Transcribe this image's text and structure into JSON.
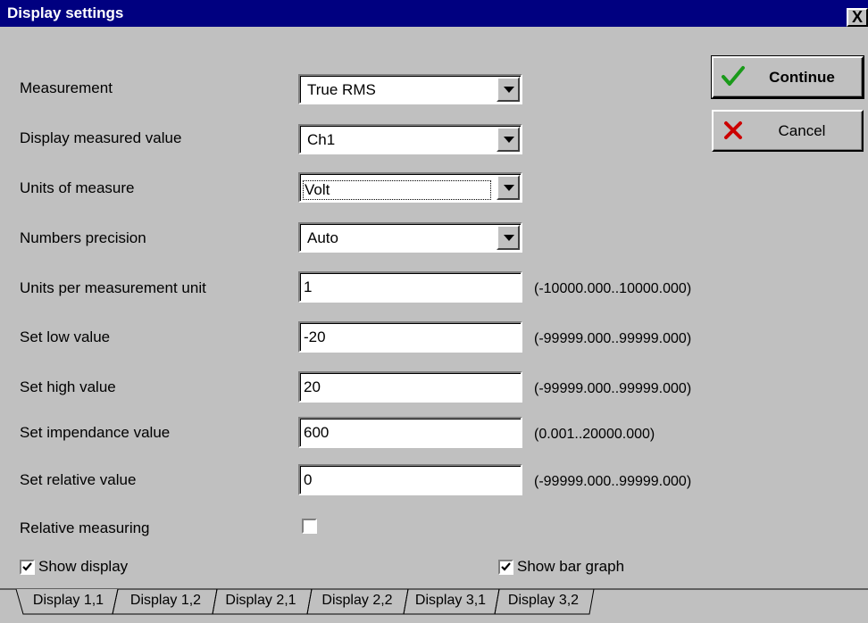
{
  "window": {
    "title": "Display settings",
    "close_label": "X"
  },
  "fields": {
    "measurement": {
      "label": "Measurement",
      "value": "True RMS"
    },
    "display_measured_value": {
      "label": "Display measured value",
      "value": "Ch1"
    },
    "units_of_measure": {
      "label": "Units of measure",
      "value": "Volt"
    },
    "numbers_precision": {
      "label": "Numbers precision",
      "value": "Auto"
    },
    "units_per_measurement_unit": {
      "label": "Units per measurement unit",
      "value": "1",
      "range": "(-10000.000..10000.000)"
    },
    "set_low_value": {
      "label": "Set low value",
      "value": "-20",
      "range": "(-99999.000..99999.000)"
    },
    "set_high_value": {
      "label": "Set high value",
      "value": "20",
      "range": "(-99999.000..99999.000)"
    },
    "set_impendance_value": {
      "label": "Set impendance value",
      "value": "600",
      "range": "(0.001..20000.000)"
    },
    "set_relative_value": {
      "label": "Set relative value",
      "value": "0",
      "range": "(-99999.000..99999.000)"
    }
  },
  "checkboxes": {
    "relative_measuring": {
      "label": "Relative measuring",
      "checked": false
    },
    "show_display": {
      "label": "Show display",
      "checked": true
    },
    "show_bar_graph": {
      "label": "Show bar graph",
      "checked": true
    }
  },
  "buttons": {
    "continue_label": "Continue",
    "cancel_label": "Cancel"
  },
  "tabs": [
    {
      "label": "Display 1,1",
      "active": true
    },
    {
      "label": "Display 1,2",
      "active": false
    },
    {
      "label": "Display 2,1",
      "active": false
    },
    {
      "label": "Display 2,2",
      "active": false
    },
    {
      "label": "Display 3,1",
      "active": false
    },
    {
      "label": "Display 3,2",
      "active": false
    }
  ],
  "icons": {
    "continue": "checkmark-icon",
    "cancel": "cross-icon",
    "close": "close-icon",
    "dropdown": "arrow-down-icon"
  },
  "colors": {
    "titlebar": "#000080",
    "face": "#c0c0c0",
    "check_green": "#1a9a1a",
    "cross_red": "#cc0000"
  }
}
